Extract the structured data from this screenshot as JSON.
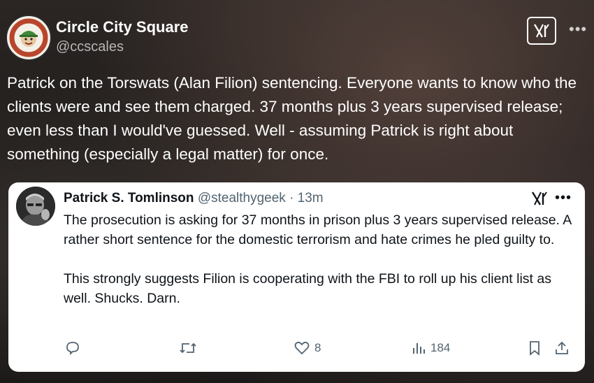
{
  "account": {
    "display_name": "Circle City Square",
    "handle": "@ccscales",
    "avatar_text": "FRIENDS OF SLUGGO",
    "avatar_color": "#b8462c"
  },
  "post": {
    "text": "Patrick on the Torswats (Alan Filion) sentencing. Everyone wants to know who the clients were and see them charged. 37 months plus 3 years supervised release; even less than I would've guessed. Well - assuming Patrick is right about something (especially a legal matter) for once."
  },
  "quoted": {
    "author_name": "Patrick S. Tomlinson",
    "author_handle": "@stealthygeek",
    "separator": "·",
    "time": "13m",
    "paragraph_1": "The prosecution is asking for 37 months in prison plus 3 years supervised release. A rather short sentence for the domestic terrorism and hate crimes he pled guilty to.",
    "paragraph_2": "This strongly suggests Filion is cooperating with the FBI to roll up his client list as well. Shucks. Darn.",
    "likes": "8",
    "views": "184"
  },
  "icons": {
    "more": "more-icon",
    "logo": "x-logo-icon",
    "reply": "reply-icon",
    "retweet": "retweet-icon",
    "like": "like-icon",
    "views": "views-icon",
    "bookmark": "bookmark-icon",
    "share": "share-icon"
  },
  "colors": {
    "card_bg": "#ffffff",
    "icon_gray": "#536471",
    "text_dark": "#0f1419",
    "handle_gray": "#b8b6b4"
  }
}
